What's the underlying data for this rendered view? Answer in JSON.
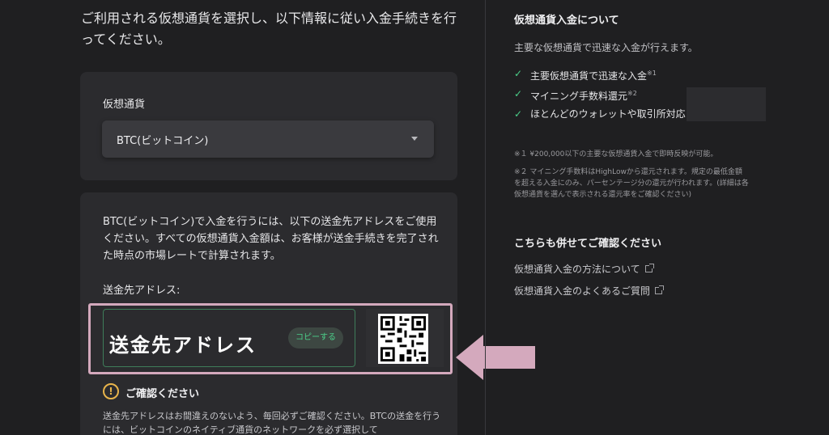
{
  "intro": {
    "text": "ご利用される仮想通貨を選択し、以下情報に従い入金手続きを行ってください。"
  },
  "currency_select": {
    "label": "仮想通貨",
    "selected": "BTC(ビットコイン)"
  },
  "address_card": {
    "description": "BTC(ビットコイン)で入金を行うには、以下の送金先アドレスをご使用ください。すべての仮想通貨入金額は、お客様が送金手続きを完了された時点の市場レートで計算されます。",
    "address_label": "送金先アドレス:",
    "address_value": "送金先アドレス",
    "copy_label": "コピーする",
    "warning_title": "ご確認ください",
    "warning_text": "送金先アドレスはお間違えのないよう、毎回必ずご確認ください。BTCの送金を行うには、ビットコインのネイティブ通貨のネットワークを必ず選択して"
  },
  "sidebar": {
    "title": "仮想通貨入金について",
    "subtitle": "主要な仮想通貨で迅速な入金が行えます。",
    "features": [
      {
        "text": "主要仮想通貨で迅速な入金",
        "sup": "※1"
      },
      {
        "text": "マイニング手数料還元",
        "sup": "※2"
      },
      {
        "text": "ほとんどのウォレットや取引所対応",
        "sup": ""
      }
    ],
    "note1": "※１ ¥200,000以下の主要な仮想通貨入金で即時反映が可能。",
    "note2": "※２ マイニング手数料はHighLowから還元されます。規定の最低金額を超える入金にのみ、パーセンテージ分の還元が行われます。(詳細は各仮想通貨を選んで表示される還元率をご確認ください)",
    "also_title": "こちらも併せてご確認ください",
    "links": [
      "仮想通貨入金の方法について",
      "仮想通貨入金のよくあるご質問"
    ]
  },
  "colors": {
    "accent_green": "#4cd08a",
    "highlight_pink": "#d4a9bd",
    "warning_amber": "#e8b44b"
  }
}
